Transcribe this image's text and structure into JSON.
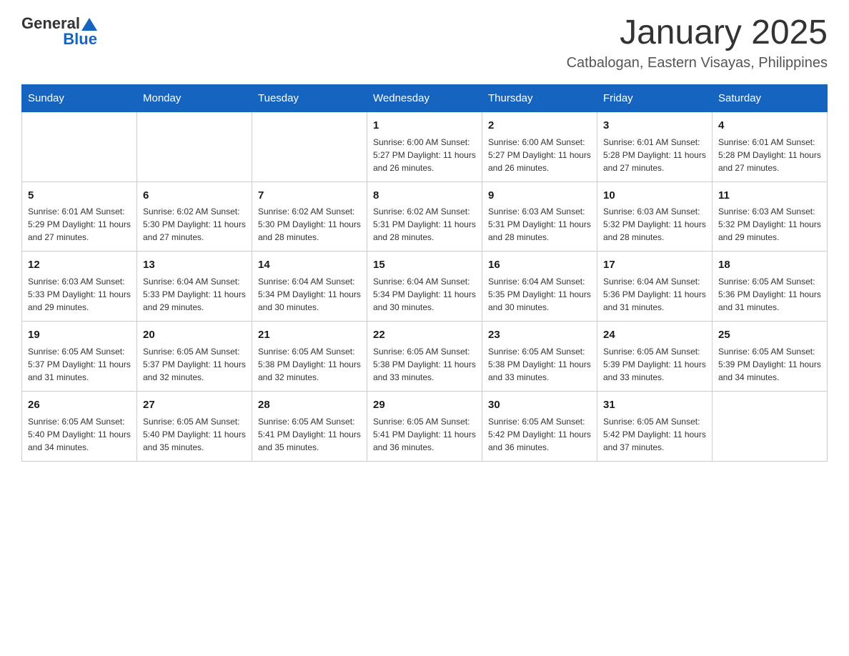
{
  "header": {
    "logo_general": "General",
    "logo_blue": "Blue",
    "month_title": "January 2025",
    "location": "Catbalogan, Eastern Visayas, Philippines"
  },
  "days_of_week": [
    "Sunday",
    "Monday",
    "Tuesday",
    "Wednesday",
    "Thursday",
    "Friday",
    "Saturday"
  ],
  "weeks": [
    [
      {
        "day": "",
        "info": ""
      },
      {
        "day": "",
        "info": ""
      },
      {
        "day": "",
        "info": ""
      },
      {
        "day": "1",
        "info": "Sunrise: 6:00 AM\nSunset: 5:27 PM\nDaylight: 11 hours and 26 minutes."
      },
      {
        "day": "2",
        "info": "Sunrise: 6:00 AM\nSunset: 5:27 PM\nDaylight: 11 hours and 26 minutes."
      },
      {
        "day": "3",
        "info": "Sunrise: 6:01 AM\nSunset: 5:28 PM\nDaylight: 11 hours and 27 minutes."
      },
      {
        "day": "4",
        "info": "Sunrise: 6:01 AM\nSunset: 5:28 PM\nDaylight: 11 hours and 27 minutes."
      }
    ],
    [
      {
        "day": "5",
        "info": "Sunrise: 6:01 AM\nSunset: 5:29 PM\nDaylight: 11 hours and 27 minutes."
      },
      {
        "day": "6",
        "info": "Sunrise: 6:02 AM\nSunset: 5:30 PM\nDaylight: 11 hours and 27 minutes."
      },
      {
        "day": "7",
        "info": "Sunrise: 6:02 AM\nSunset: 5:30 PM\nDaylight: 11 hours and 28 minutes."
      },
      {
        "day": "8",
        "info": "Sunrise: 6:02 AM\nSunset: 5:31 PM\nDaylight: 11 hours and 28 minutes."
      },
      {
        "day": "9",
        "info": "Sunrise: 6:03 AM\nSunset: 5:31 PM\nDaylight: 11 hours and 28 minutes."
      },
      {
        "day": "10",
        "info": "Sunrise: 6:03 AM\nSunset: 5:32 PM\nDaylight: 11 hours and 28 minutes."
      },
      {
        "day": "11",
        "info": "Sunrise: 6:03 AM\nSunset: 5:32 PM\nDaylight: 11 hours and 29 minutes."
      }
    ],
    [
      {
        "day": "12",
        "info": "Sunrise: 6:03 AM\nSunset: 5:33 PM\nDaylight: 11 hours and 29 minutes."
      },
      {
        "day": "13",
        "info": "Sunrise: 6:04 AM\nSunset: 5:33 PM\nDaylight: 11 hours and 29 minutes."
      },
      {
        "day": "14",
        "info": "Sunrise: 6:04 AM\nSunset: 5:34 PM\nDaylight: 11 hours and 30 minutes."
      },
      {
        "day": "15",
        "info": "Sunrise: 6:04 AM\nSunset: 5:34 PM\nDaylight: 11 hours and 30 minutes."
      },
      {
        "day": "16",
        "info": "Sunrise: 6:04 AM\nSunset: 5:35 PM\nDaylight: 11 hours and 30 minutes."
      },
      {
        "day": "17",
        "info": "Sunrise: 6:04 AM\nSunset: 5:36 PM\nDaylight: 11 hours and 31 minutes."
      },
      {
        "day": "18",
        "info": "Sunrise: 6:05 AM\nSunset: 5:36 PM\nDaylight: 11 hours and 31 minutes."
      }
    ],
    [
      {
        "day": "19",
        "info": "Sunrise: 6:05 AM\nSunset: 5:37 PM\nDaylight: 11 hours and 31 minutes."
      },
      {
        "day": "20",
        "info": "Sunrise: 6:05 AM\nSunset: 5:37 PM\nDaylight: 11 hours and 32 minutes."
      },
      {
        "day": "21",
        "info": "Sunrise: 6:05 AM\nSunset: 5:38 PM\nDaylight: 11 hours and 32 minutes."
      },
      {
        "day": "22",
        "info": "Sunrise: 6:05 AM\nSunset: 5:38 PM\nDaylight: 11 hours and 33 minutes."
      },
      {
        "day": "23",
        "info": "Sunrise: 6:05 AM\nSunset: 5:38 PM\nDaylight: 11 hours and 33 minutes."
      },
      {
        "day": "24",
        "info": "Sunrise: 6:05 AM\nSunset: 5:39 PM\nDaylight: 11 hours and 33 minutes."
      },
      {
        "day": "25",
        "info": "Sunrise: 6:05 AM\nSunset: 5:39 PM\nDaylight: 11 hours and 34 minutes."
      }
    ],
    [
      {
        "day": "26",
        "info": "Sunrise: 6:05 AM\nSunset: 5:40 PM\nDaylight: 11 hours and 34 minutes."
      },
      {
        "day": "27",
        "info": "Sunrise: 6:05 AM\nSunset: 5:40 PM\nDaylight: 11 hours and 35 minutes."
      },
      {
        "day": "28",
        "info": "Sunrise: 6:05 AM\nSunset: 5:41 PM\nDaylight: 11 hours and 35 minutes."
      },
      {
        "day": "29",
        "info": "Sunrise: 6:05 AM\nSunset: 5:41 PM\nDaylight: 11 hours and 36 minutes."
      },
      {
        "day": "30",
        "info": "Sunrise: 6:05 AM\nSunset: 5:42 PM\nDaylight: 11 hours and 36 minutes."
      },
      {
        "day": "31",
        "info": "Sunrise: 6:05 AM\nSunset: 5:42 PM\nDaylight: 11 hours and 37 minutes."
      },
      {
        "day": "",
        "info": ""
      }
    ]
  ]
}
